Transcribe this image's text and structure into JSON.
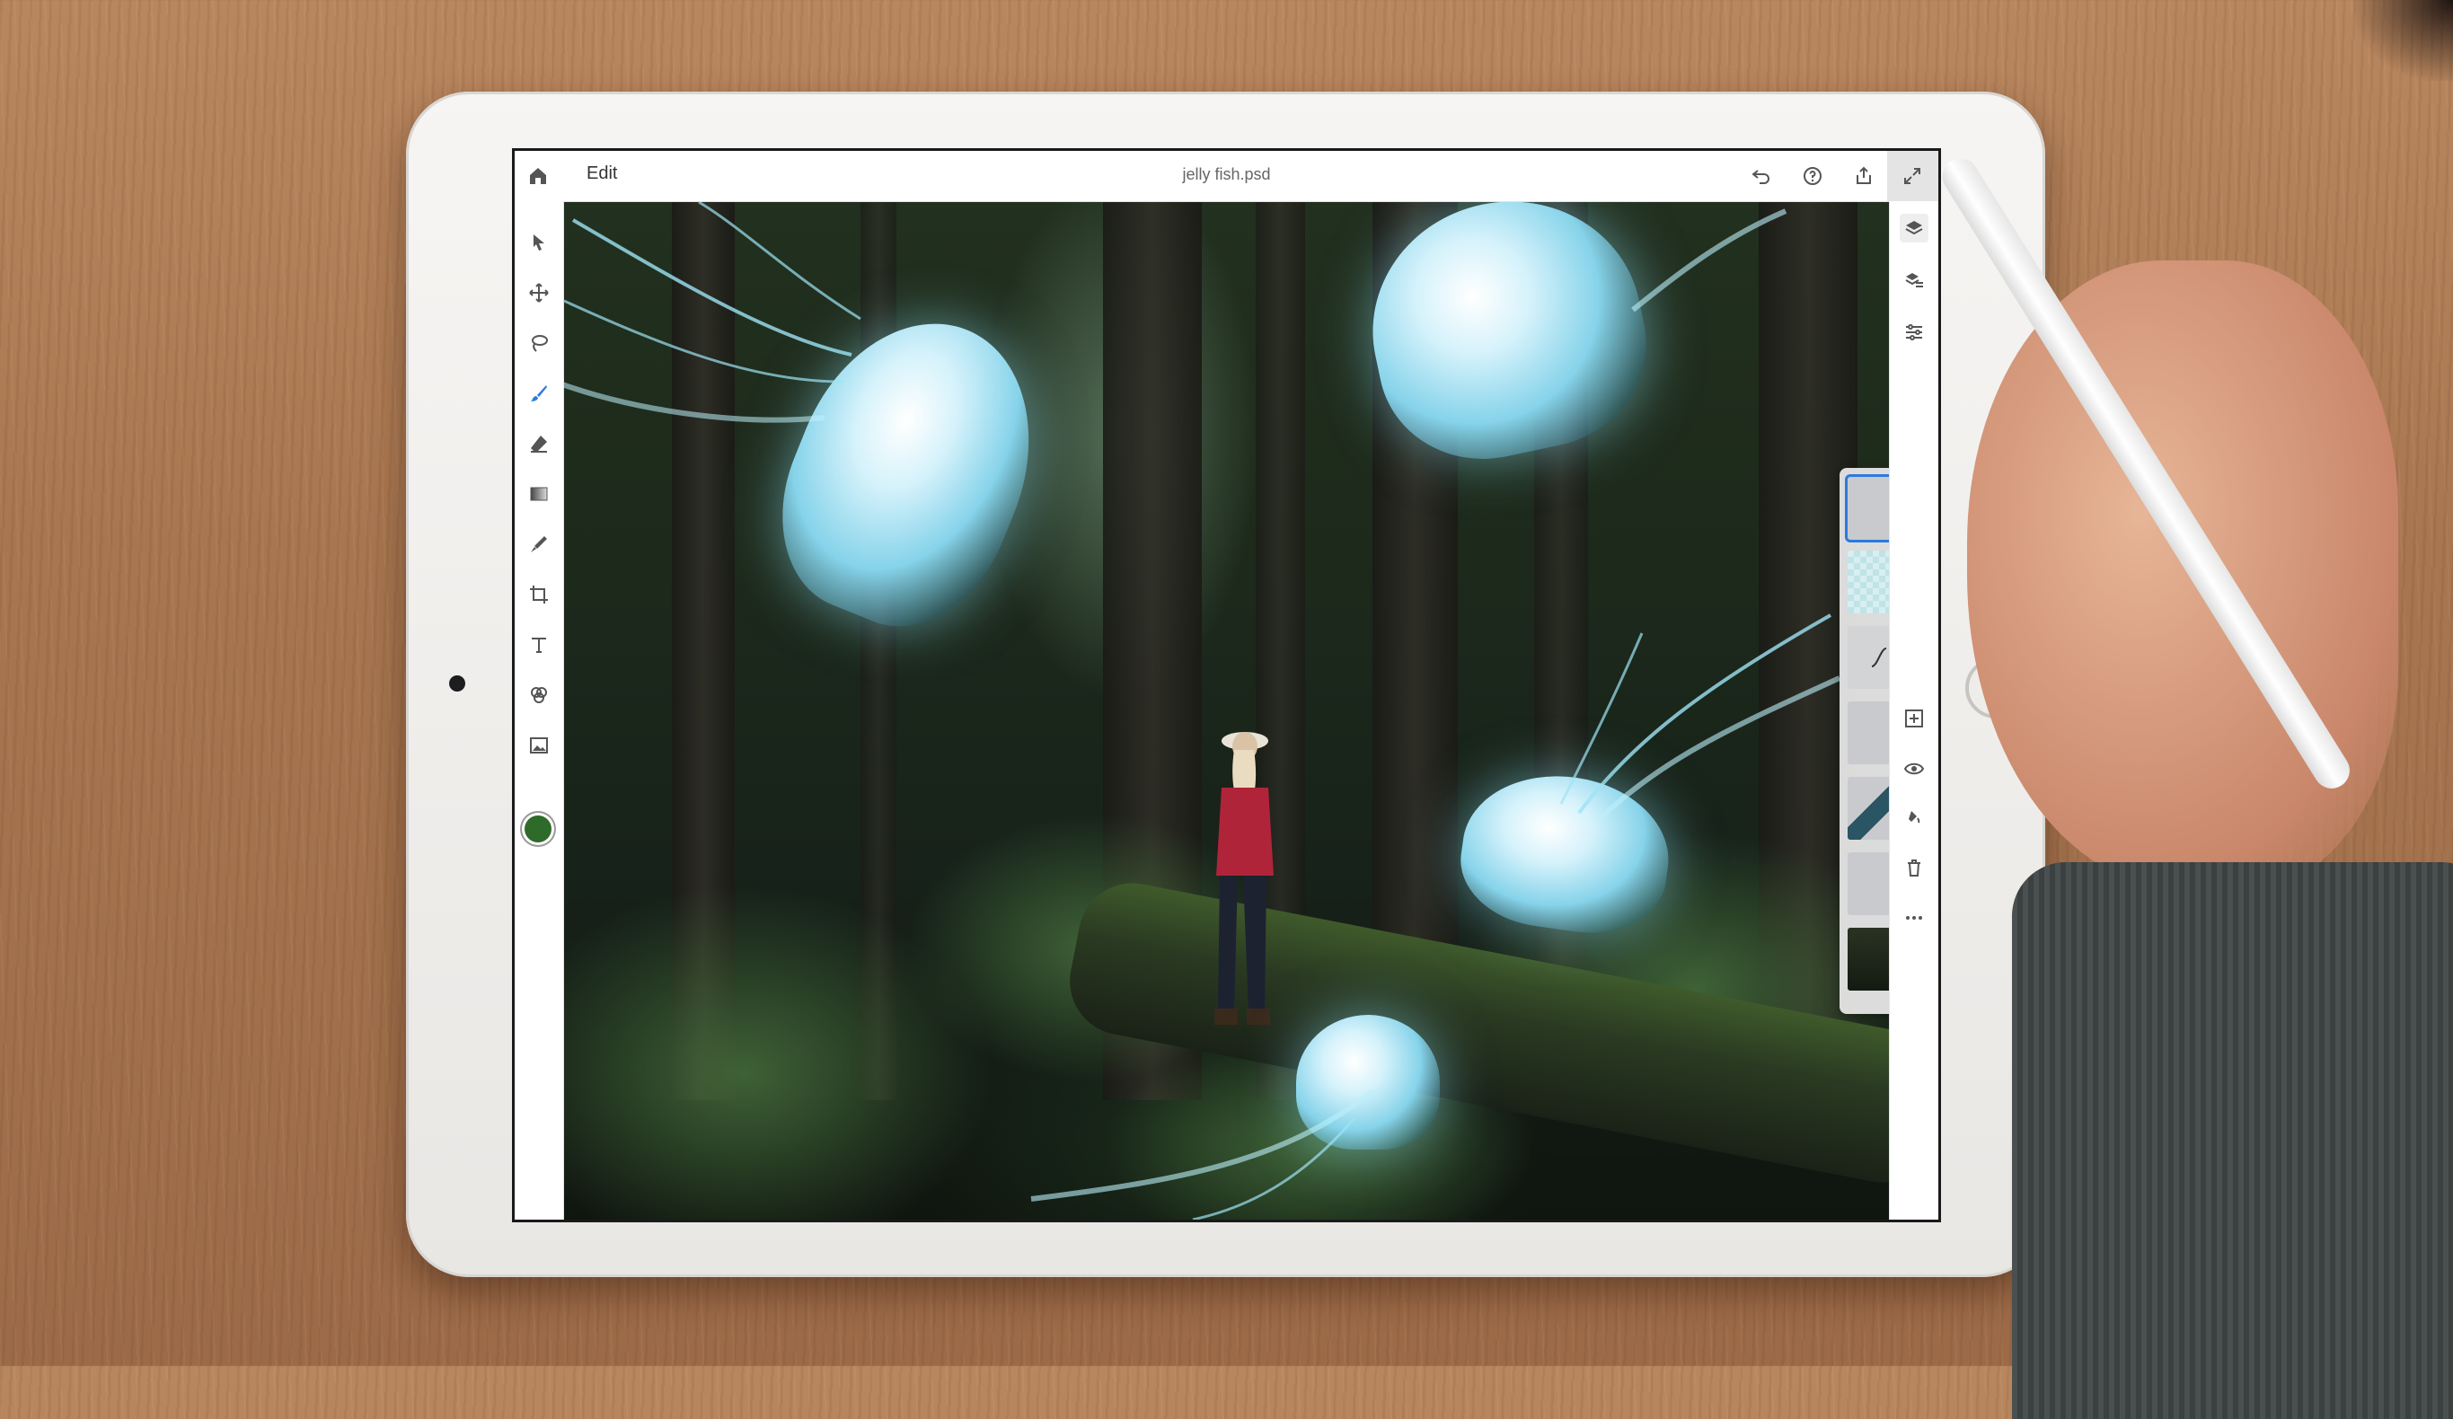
{
  "app": {
    "document_title": "jelly fish.psd",
    "menu_label": "Edit"
  },
  "toolbar_left": [
    "select-icon",
    "move-icon",
    "lasso-icon",
    "brush-icon",
    "eraser-icon",
    "gradient-icon",
    "healing-icon",
    "crop-icon",
    "type-icon",
    "adjustments-icon",
    "place-image-icon"
  ],
  "toolbar_top_right": [
    "undo-icon",
    "help-icon",
    "share-icon",
    "expand-icon"
  ],
  "toolbar_right": [
    "layers-icon",
    "layer-properties-icon",
    "adjustment-sliders-icon",
    "add-layer-icon",
    "visibility-icon",
    "fill-icon",
    "delete-icon",
    "more-icon"
  ],
  "foreground_color": "#2e6b2a",
  "layers": {
    "count": 7,
    "selected_index": 0
  }
}
